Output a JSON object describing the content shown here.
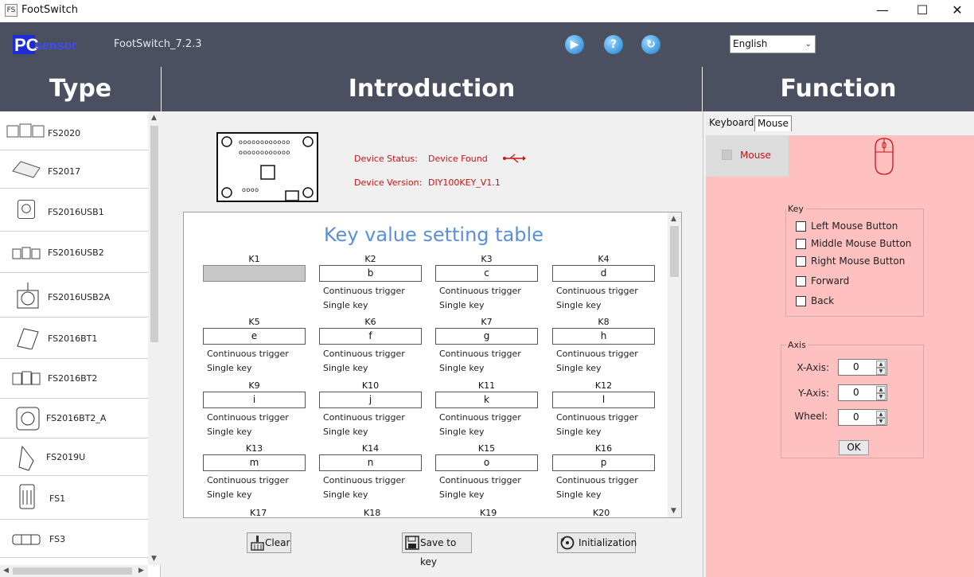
{
  "window": {
    "title": "FootSwitch",
    "icon_text": "FS",
    "minimize": "—",
    "maximize": "☐",
    "close": "✕"
  },
  "topbar": {
    "logo_text": "PCsensor",
    "version": "FootSwitch_7.2.3",
    "language": "English",
    "icons": [
      "play-icon",
      "help-icon",
      "refresh-icon"
    ]
  },
  "sections": {
    "type": "Type",
    "introduction": "Introduction",
    "function": "Function"
  },
  "types": [
    {
      "label": "FS2020"
    },
    {
      "label": "FS2017"
    },
    {
      "label": "FS2016USB1"
    },
    {
      "label": "FS2016USB2"
    },
    {
      "label": "FS2016USB2A"
    },
    {
      "label": "FS2016BT1"
    },
    {
      "label": "FS2016BT2"
    },
    {
      "label": "FS2016BT2_A"
    },
    {
      "label": "FS2019U"
    },
    {
      "label": "FS1"
    },
    {
      "label": "FS3"
    }
  ],
  "device": {
    "status_label": "Device Status:",
    "status_value": "Device Found",
    "version_label": "Device Version:",
    "version_value": "DIY100KEY_V1.1",
    "dots_row1": "oooooooooooo",
    "dots_row2": "oooooooooooo",
    "dots_row3": "oooo"
  },
  "key_table": {
    "title": "Key value setting table",
    "trigger": "Continuous trigger",
    "mode": "Single key",
    "keys": [
      {
        "label": "K1",
        "value": ""
      },
      {
        "label": "K2",
        "value": "b"
      },
      {
        "label": "K3",
        "value": "c"
      },
      {
        "label": "K4",
        "value": "d"
      },
      {
        "label": "K5",
        "value": "e"
      },
      {
        "label": "K6",
        "value": "f"
      },
      {
        "label": "K7",
        "value": "g"
      },
      {
        "label": "K8",
        "value": "h"
      },
      {
        "label": "K9",
        "value": "i"
      },
      {
        "label": "K10",
        "value": "j"
      },
      {
        "label": "K11",
        "value": "k"
      },
      {
        "label": "K12",
        "value": "l"
      },
      {
        "label": "K13",
        "value": "m"
      },
      {
        "label": "K14",
        "value": "n"
      },
      {
        "label": "K15",
        "value": "o"
      },
      {
        "label": "K16",
        "value": "p"
      }
    ],
    "next_row": [
      "K17",
      "K18",
      "K19",
      "K20"
    ]
  },
  "actions": {
    "clear": "Clear",
    "save": "Save to key",
    "init": "Initialization"
  },
  "function": {
    "tabs": [
      "Keyboard",
      "Mouse"
    ],
    "active_tab": "Mouse",
    "mode_label": "Mouse",
    "key_group": "Key",
    "buttons": [
      "Left Mouse Button",
      "Middle Mouse Button",
      "Right Mouse Button",
      "Forward",
      "Back"
    ],
    "axis_group": "Axis",
    "axes": [
      {
        "label": "X-Axis:",
        "value": "0"
      },
      {
        "label": "Y-Axis:",
        "value": "0"
      },
      {
        "label": "Wheel:",
        "value": "0"
      }
    ],
    "ok": "OK"
  },
  "colors": {
    "header_bg": "#4a5060",
    "status_red": "#c81414",
    "title_blue": "#5a8fd9",
    "function_bg": "#ffc0c0"
  }
}
